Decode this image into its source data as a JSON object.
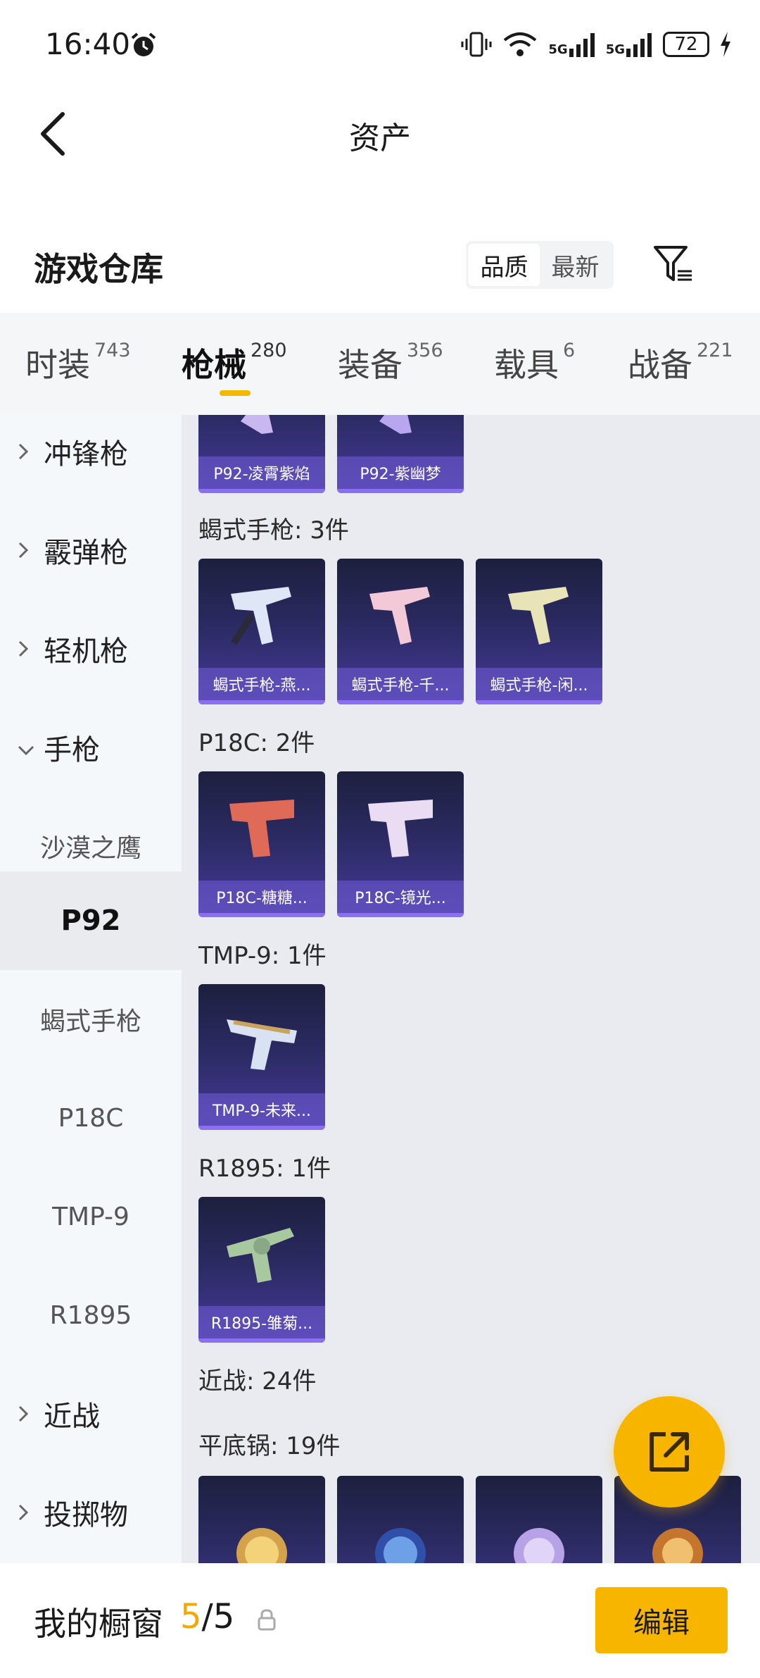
{
  "status": {
    "time": "16:40",
    "battery": "72",
    "network1": "5G",
    "network2": "5G"
  },
  "header": {
    "title": "资产"
  },
  "section": {
    "title": "游戏仓库",
    "sort_options": [
      "品质",
      "最新"
    ]
  },
  "tabs": [
    {
      "label": "时装",
      "count": "743"
    },
    {
      "label": "枪械",
      "count": "280"
    },
    {
      "label": "装备",
      "count": "356"
    },
    {
      "label": "载具",
      "count": "6"
    },
    {
      "label": "战备",
      "count": "221"
    }
  ],
  "sidebar": {
    "groups": {
      "smg": "冲锋枪",
      "shotgun": "霰弹枪",
      "lmg": "轻机枪",
      "pistol": "手枪",
      "melee": "近战",
      "throwable": "投掷物"
    },
    "subs": {
      "desert_eagle": "沙漠之鹰",
      "p92": "P92",
      "scorpion": "蝎式手枪",
      "p18c": "P18C",
      "tmp9": "TMP-9",
      "r1895": "R1895"
    }
  },
  "content": {
    "top_items": [
      "P92-凌霄紫焰",
      "P92-紫幽梦"
    ],
    "groups": [
      {
        "label": "蝎式手枪: 3件",
        "items": [
          "蝎式手枪-燕...",
          "蝎式手枪-千...",
          "蝎式手枪-闲..."
        ]
      },
      {
        "label": "P18C: 2件",
        "items": [
          "P18C-糖糖...",
          "P18C-镜光..."
        ]
      },
      {
        "label": "TMP-9: 1件",
        "items": [
          "TMP-9-未来..."
        ]
      },
      {
        "label": "R1895: 1件",
        "items": [
          "R1895-雏菊..."
        ]
      }
    ],
    "melee_label": "近战: 24件",
    "pan_label": "平底锅: 19件"
  },
  "bottom": {
    "showcase_label": "我的橱窗",
    "current": "5",
    "total": "/5",
    "edit_label": "编辑"
  },
  "colors": {
    "accent": "#f7b500",
    "card_top": "#1d1f3e",
    "card_bottom": "#463a9a"
  }
}
